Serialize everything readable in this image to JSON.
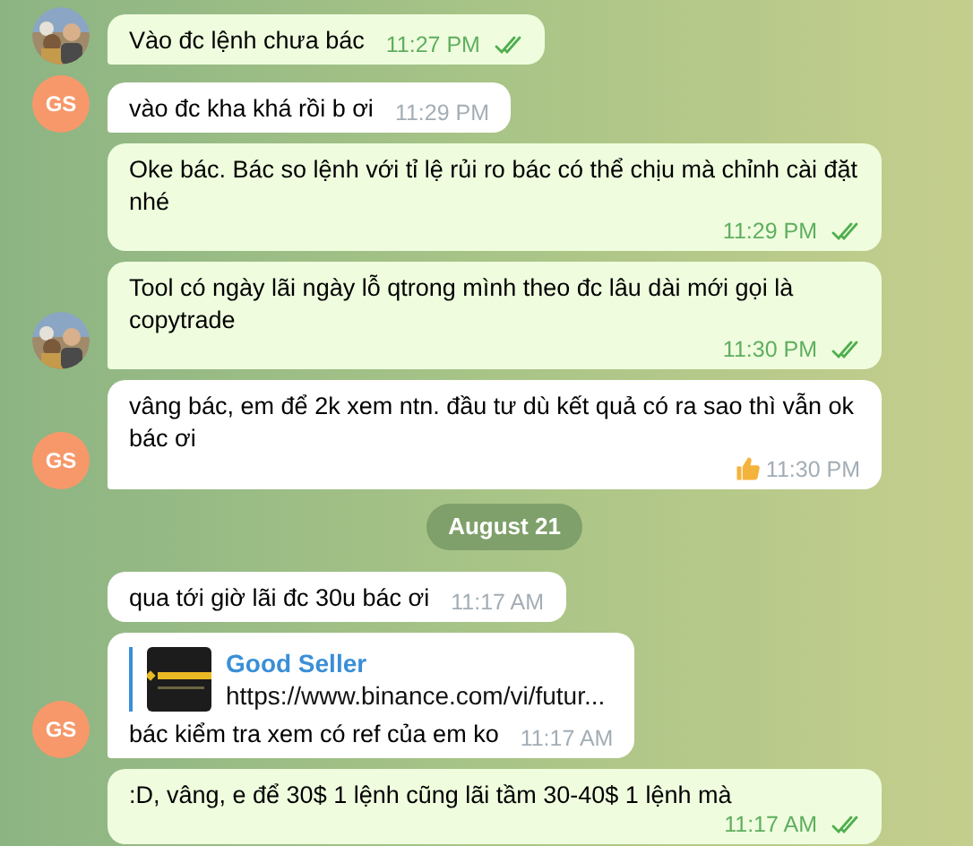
{
  "messages": [
    {
      "kind": "message",
      "outgoing": true,
      "photo_avatar": true,
      "text": "Vào đc lệnh chưa bác",
      "time": "11:27 PM",
      "read": true
    },
    {
      "kind": "message",
      "outgoing": false,
      "initials": "GS",
      "text": "vào đc kha khá rồi b ơi",
      "time": "11:29 PM"
    },
    {
      "kind": "message",
      "outgoing": true,
      "text": "Oke bác. Bác so lệnh với tỉ lệ rủi ro bác có thể chịu mà chỉnh cài đặt nhé",
      "time": "11:29 PM",
      "read": true
    },
    {
      "kind": "message",
      "outgoing": true,
      "photo_avatar": true,
      "text": "Tool có ngày lãi ngày lỗ qtrong mình theo đc lâu dài mới gọi là copytrade",
      "time": "11:30 PM",
      "read": true
    },
    {
      "kind": "message",
      "outgoing": false,
      "initials": "GS",
      "text": "vâng bác, em để 2k xem ntn. đầu tư dù kết quả có ra sao thì vẫn ok bác ơi",
      "time": "11:30 PM",
      "liked": true
    },
    {
      "kind": "date",
      "text": "August 21"
    },
    {
      "kind": "message",
      "outgoing": false,
      "text": "qua tới giờ lãi đc 30u bác ơi",
      "time": "11:17 AM"
    },
    {
      "kind": "message",
      "outgoing": false,
      "initials": "GS",
      "link": {
        "title": "Good Seller",
        "url": "https://www.binance.com/vi/futur..."
      },
      "text": "bác kiểm tra xem có ref của em ko",
      "time": "11:17 AM"
    },
    {
      "kind": "message",
      "outgoing": true,
      "text": ":D, vâng, e để 30$ 1 lệnh cũng lãi tầm 30-40$ 1 lệnh mà",
      "time": "11:17 AM",
      "read": true
    }
  ]
}
